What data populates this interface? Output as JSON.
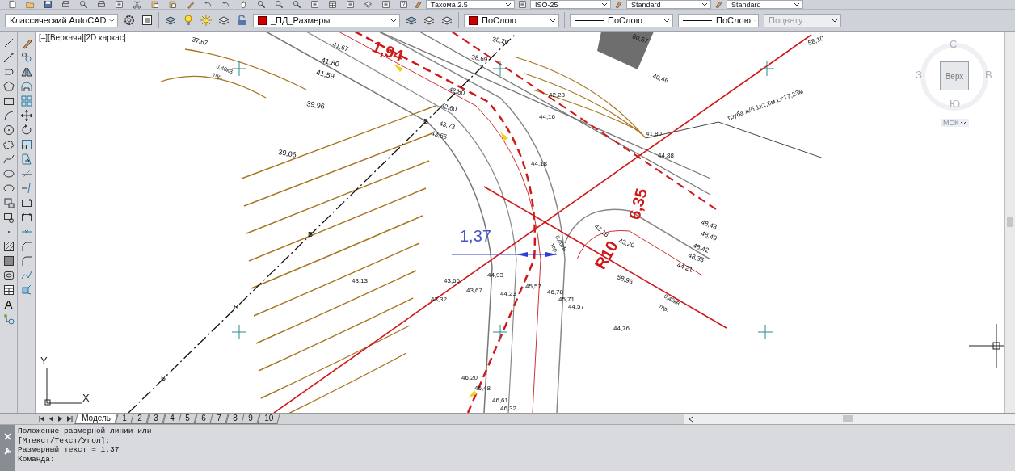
{
  "toolbar_top": {
    "dropdowns": [
      "Тахома 2.5",
      "ISO-25",
      "Standard",
      "Standard"
    ]
  },
  "toolbar_properties": {
    "workspace": "Классический AutoCAD",
    "layer": "_ПД_Размеры",
    "color_dropdown": "ПоСлою",
    "linetype": "ПоСлою",
    "lineweight": "ПоСлою",
    "plot_style": {
      "text": "Поцвету",
      "disabled": true
    }
  },
  "draw_toolbar": {
    "text_tool_glyph": "A"
  },
  "viewport": {
    "label": "[–][Верхняя][2D каркас]"
  },
  "viewcube": {
    "north": "С",
    "west": "З",
    "east": "В",
    "south": "Ю",
    "face": "Верх",
    "ucs": "МСК"
  },
  "ucs_icon": {
    "x": "X",
    "y": "Y"
  },
  "drawing_labels": [
    {
      "text": "37,67",
      "kind": "elevation"
    },
    {
      "text": "41,67",
      "kind": "elevation"
    },
    {
      "text": "41,80",
      "kind": "elevation"
    },
    {
      "text": "41,59",
      "kind": "elevation"
    },
    {
      "text": "39,96",
      "kind": "elevation"
    },
    {
      "text": "39,06",
      "kind": "elevation"
    },
    {
      "text": "38,26",
      "kind": "elevation"
    },
    {
      "text": "38,69",
      "kind": "elevation"
    },
    {
      "text": "42,80",
      "kind": "elevation"
    },
    {
      "text": "42,60",
      "kind": "elevation"
    },
    {
      "text": "43,73",
      "kind": "elevation"
    },
    {
      "text": "43,66",
      "kind": "elevation"
    },
    {
      "text": "42,28",
      "kind": "elevation"
    },
    {
      "text": "44,16",
      "kind": "elevation"
    },
    {
      "text": "44,18",
      "kind": "elevation"
    },
    {
      "text": "80,57",
      "kind": "elevation"
    },
    {
      "text": "40,46",
      "kind": "elevation"
    },
    {
      "text": "41,80",
      "kind": "elevation"
    },
    {
      "text": "44,88",
      "kind": "elevation"
    },
    {
      "text": "43,16",
      "kind": "elevation"
    },
    {
      "text": "43,20",
      "kind": "elevation"
    },
    {
      "text": "48,43",
      "kind": "elevation"
    },
    {
      "text": "48,49",
      "kind": "elevation"
    },
    {
      "text": "48,42",
      "kind": "elevation"
    },
    {
      "text": "48,35",
      "kind": "elevation"
    },
    {
      "text": "44,21",
      "kind": "elevation"
    },
    {
      "text": "43,13",
      "kind": "elevation"
    },
    {
      "text": "43,66",
      "kind": "elevation"
    },
    {
      "text": "44,93",
      "kind": "elevation"
    },
    {
      "text": "43,67",
      "kind": "elevation"
    },
    {
      "text": "43,32",
      "kind": "elevation"
    },
    {
      "text": "44,23",
      "kind": "elevation"
    },
    {
      "text": "45,57",
      "kind": "elevation"
    },
    {
      "text": "46,78",
      "kind": "elevation"
    },
    {
      "text": "45,71",
      "kind": "elevation"
    },
    {
      "text": "44,57",
      "kind": "elevation"
    },
    {
      "text": "44,76",
      "kind": "elevation"
    },
    {
      "text": "46,20",
      "kind": "elevation"
    },
    {
      "text": "46,48",
      "kind": "elevation"
    },
    {
      "text": "46,61",
      "kind": "elevation"
    },
    {
      "text": "46,32",
      "kind": "elevation"
    },
    {
      "text": "58,10",
      "kind": "elevation"
    },
    {
      "text": "58,96",
      "kind": "elevation"
    },
    {
      "text": "1,37",
      "kind": "dimension"
    },
    {
      "text": "1,94",
      "kind": "callout"
    },
    {
      "text": "6,35",
      "kind": "callout"
    },
    {
      "text": "R10",
      "kind": "callout"
    },
    {
      "text": "0,40кВ",
      "kind": "note"
    },
    {
      "text": "тпр.",
      "kind": "note"
    },
    {
      "text": "0,40кВ",
      "kind": "note"
    },
    {
      "text": "тпр.",
      "kind": "note"
    },
    {
      "text": "0,40кВ",
      "kind": "note"
    },
    {
      "text": "тпр.",
      "kind": "note"
    },
    {
      "text": "труба ж/б 1х1,6м L=17,23м",
      "kind": "note"
    },
    {
      "text": "В",
      "kind": "line_mark"
    },
    {
      "text": "В",
      "kind": "line_mark"
    },
    {
      "text": "В",
      "kind": "line_mark"
    },
    {
      "text": "В",
      "kind": "line_mark"
    }
  ],
  "layout_tabs": [
    {
      "label": "Модель",
      "selected": true
    },
    {
      "label": "1",
      "selected": false
    },
    {
      "label": "2",
      "selected": false
    },
    {
      "label": "3",
      "selected": false
    },
    {
      "label": "4",
      "selected": false
    },
    {
      "label": "5",
      "selected": false
    },
    {
      "label": "6",
      "selected": false
    },
    {
      "label": "7",
      "selected": false
    },
    {
      "label": "8",
      "selected": false
    },
    {
      "label": "9",
      "selected": false
    },
    {
      "label": "10",
      "selected": false
    }
  ],
  "command_line": {
    "history": [
      "Положение размерной линии или",
      "[Мтекст/Текст/Угол]:",
      "Размерный текст = 1.37"
    ],
    "prompt": "Команда:"
  }
}
